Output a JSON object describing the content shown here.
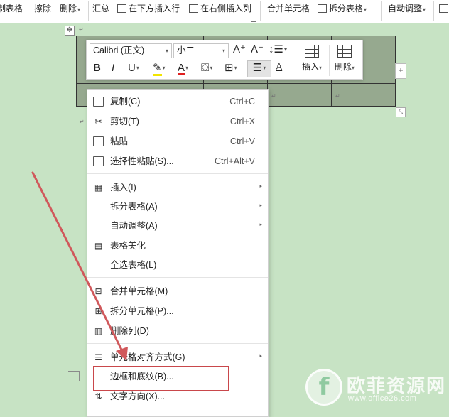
{
  "ribbon": {
    "draw_table": "制表格",
    "erase": "擦除",
    "delete": "删除",
    "summarize": "汇总",
    "insert_below": "在下方插入行",
    "insert_right": "在右侧插入列",
    "merge_cells": "合并单元格",
    "split_table": "拆分表格",
    "auto_fit": "自动调整"
  },
  "mini_toolbar": {
    "font_name": "Calibri (正文)",
    "font_size": "小二",
    "insert_label": "插入",
    "delete_label": "删除",
    "bold": "B",
    "italic": "I",
    "underline": "U",
    "font_color_letter": "A",
    "grow": "A⁺",
    "shrink": "A⁻"
  },
  "context_menu": {
    "items": [
      {
        "label": "复制(C)",
        "shortcut": "Ctrl+C",
        "icon": "copy-icon"
      },
      {
        "label": "剪切(T)",
        "shortcut": "Ctrl+X",
        "icon": "scissors-icon"
      },
      {
        "label": "粘贴",
        "shortcut": "Ctrl+V",
        "icon": "paste-icon"
      },
      {
        "label": "选择性粘贴(S)...",
        "shortcut": "Ctrl+Alt+V",
        "icon": "paste-special-icon"
      },
      {
        "label": "插入(I)",
        "icon": "table-insert-icon"
      },
      {
        "label": "拆分表格(A)"
      },
      {
        "label": "自动调整(A)"
      },
      {
        "label": "表格美化",
        "icon": "table-style-icon"
      },
      {
        "label": "全选表格(L)"
      },
      {
        "label": "合并单元格(M)",
        "icon": "merge-cells-icon"
      },
      {
        "label": "拆分单元格(P)...",
        "icon": "split-cells-icon"
      },
      {
        "label": "删除列(D)",
        "icon": "delete-column-icon"
      },
      {
        "label": "单元格对齐方式(G)",
        "icon": "cell-align-icon"
      },
      {
        "label": "边框和底纹(B)..."
      },
      {
        "label": "文字方向(X)...",
        "icon": "text-direction-icon"
      }
    ]
  },
  "watermark": {
    "brand_cn": "欧菲资源网",
    "brand_url": "www.office26.com"
  },
  "colors": {
    "page_bg": "#c7e3c4",
    "table_fill": "#96a98f",
    "highlight": "#c9474b",
    "arrow": "#d0585b"
  }
}
